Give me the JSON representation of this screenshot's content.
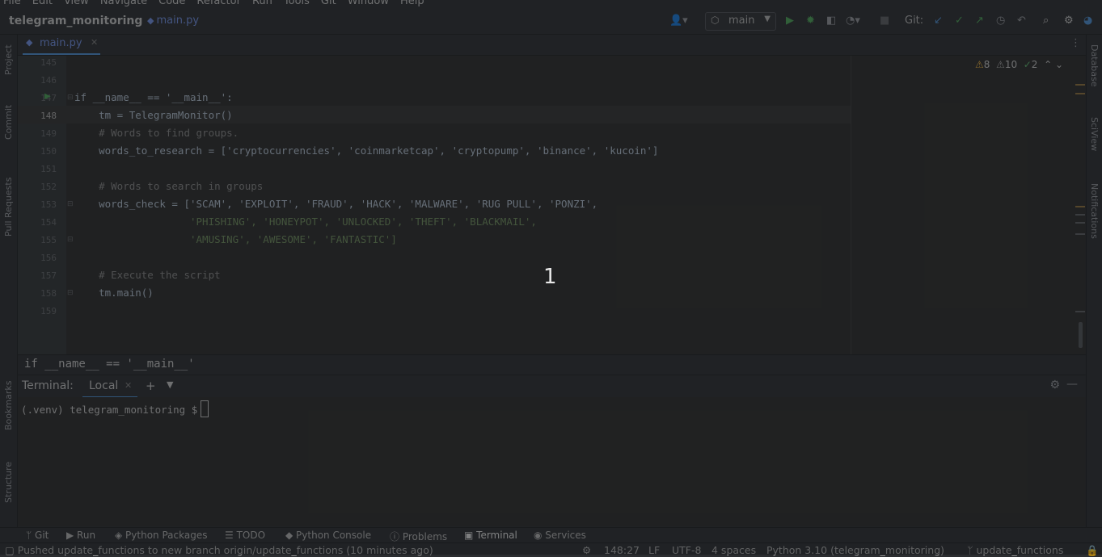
{
  "menu": [
    "File",
    "Edit",
    "View",
    "Navigate",
    "Code",
    "Refactor",
    "Run",
    "Tools",
    "Git",
    "Window",
    "Help"
  ],
  "toolbar": {
    "project": "telegram_monitoring",
    "file": "main.py",
    "branch": "main",
    "git_label": "Git:"
  },
  "left_strip": [
    "Project",
    "Commit",
    "Pull Requests",
    "Bookmarks",
    "Structure"
  ],
  "right_strip": [
    "Database",
    "SciView",
    "Notifications"
  ],
  "tab": {
    "label": "main.py"
  },
  "inspections": {
    "warnings": "8",
    "weak_warnings": "10",
    "ok": "2"
  },
  "editor": {
    "lines": [
      {
        "n": "145",
        "text": ""
      },
      {
        "n": "146",
        "text": ""
      },
      {
        "n": "147",
        "text": "if __name__ == '__main__':"
      },
      {
        "n": "148",
        "text": "    tm = TelegramMonitor()"
      },
      {
        "n": "149",
        "text": "    # Words to find groups."
      },
      {
        "n": "150",
        "text": "    words_to_research = ['cryptocurrencies', 'coinmarketcap', 'cryptopump', 'binance', 'kucoin']"
      },
      {
        "n": "151",
        "text": ""
      },
      {
        "n": "152",
        "text": "    # Words to search in groups"
      },
      {
        "n": "153",
        "text": "    words_check = ['SCAM', 'EXPLOIT', 'FRAUD', 'HACK', 'MALWARE', 'RUG PULL', 'PONZI',"
      },
      {
        "n": "154",
        "text": "                   'PHISHING', 'HONEYPOT', 'UNLOCKED', 'THEFT', 'BLACKMAIL',"
      },
      {
        "n": "155",
        "text": "                   'AMUSING', 'AWESOME', 'FANTASTIC']"
      },
      {
        "n": "156",
        "text": ""
      },
      {
        "n": "157",
        "text": "    # Execute the script"
      },
      {
        "n": "158",
        "text": "    tm.main()"
      },
      {
        "n": "159",
        "text": ""
      }
    ]
  },
  "breadcrumb": "if __name__ == '__main__'",
  "terminal": {
    "title": "Terminal:",
    "tab": "Local",
    "prompt": "(.venv) telegram_monitoring $"
  },
  "tool_tabs": [
    "Git",
    "Run",
    "Python Packages",
    "TODO",
    "Python Console",
    "Problems",
    "Terminal",
    "Services"
  ],
  "status": {
    "message": "Pushed update_functions to new branch origin/update_functions (10 minutes ago)",
    "position": "148:27",
    "line_sep": "LF",
    "encoding": "UTF-8",
    "indent": "4 spaces",
    "interpreter": "Python 3.10 (telegram_monitoring)",
    "branch": "update_functions"
  },
  "overlay_badge": "1",
  "colors": {
    "keyword": "#cc7832",
    "string": "#6a8759",
    "comment": "#808080",
    "accent": "#4a88c7"
  }
}
